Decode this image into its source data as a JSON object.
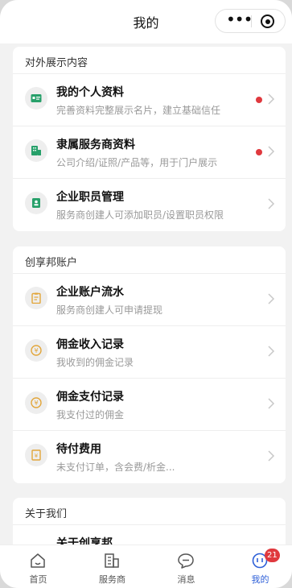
{
  "header": {
    "title": "我的"
  },
  "sections": [
    {
      "title": "对外展示内容",
      "items": [
        {
          "title": "我的个人资料",
          "subtitle": "完善资料完整展示名片，建立基础信任",
          "dot": true
        },
        {
          "title": "隶属服务商资料",
          "subtitle": "公司介绍/证照/产品等，用于门户展示",
          "dot": true
        },
        {
          "title": "企业职员管理",
          "subtitle": "服务商创建人可添加职员/设置职员权限",
          "dot": false
        }
      ]
    },
    {
      "title": "创享邦账户",
      "items": [
        {
          "title": "企业账户流水",
          "subtitle": "服务商创建人可申请提现",
          "dot": false
        },
        {
          "title": "佣金收入记录",
          "subtitle": "我收到的佣金记录",
          "dot": false
        },
        {
          "title": "佣金支付记录",
          "subtitle": "我支付过的佣金",
          "dot": false
        },
        {
          "title": "待付费用",
          "subtitle": "未支付订单，含会费/析金...",
          "dot": false
        }
      ]
    },
    {
      "title": "关于我们",
      "items": [
        {
          "title": "关于创享邦",
          "subtitle": "",
          "dot": false
        }
      ]
    }
  ],
  "tabbar": {
    "items": [
      {
        "label": "首页"
      },
      {
        "label": "服务商"
      },
      {
        "label": "消息"
      },
      {
        "label": "我的",
        "badge": "21"
      }
    ]
  },
  "colors": {
    "accent": "#2d5fd8",
    "green": "#27a06a",
    "orange": "#e2a63b",
    "red": "#e0393e"
  }
}
